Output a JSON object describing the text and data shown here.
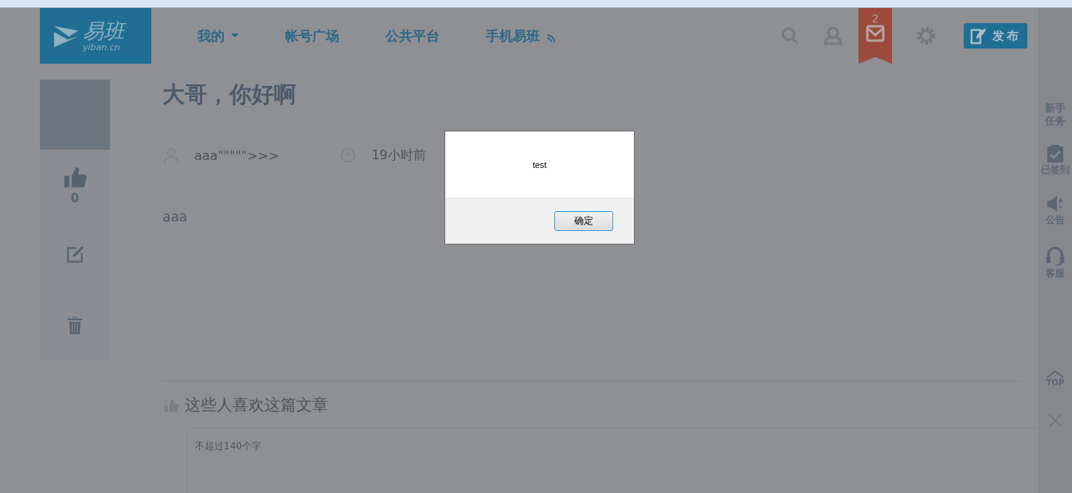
{
  "header": {
    "logo": {
      "name": "易班",
      "domain": "yiban.cn"
    },
    "nav": [
      {
        "label": "我的",
        "dropdown": true,
        "signal": false
      },
      {
        "label": "帐号广场",
        "dropdown": false,
        "signal": false
      },
      {
        "label": "公共平台",
        "dropdown": false,
        "signal": false
      },
      {
        "label": "手机易班",
        "dropdown": false,
        "signal": true
      }
    ],
    "mail_count": "2",
    "publish_button": "发布"
  },
  "side_actions": [
    {
      "kind": "like",
      "count": "0"
    },
    {
      "kind": "edit"
    },
    {
      "kind": "delete"
    }
  ],
  "article": {
    "title": "大哥，你好啊",
    "author": "aaa\"\"\"\"\">>>",
    "time": "19小时前",
    "body": "aaa"
  },
  "likes": {
    "heading": "这些人喜欢这篇文章"
  },
  "comment": {
    "placeholder": "不超过140个字"
  },
  "right_rail": [
    {
      "kind": "task",
      "label": "新手任务"
    },
    {
      "kind": "checkin",
      "label": "已签到"
    },
    {
      "kind": "notice",
      "label": "公告"
    },
    {
      "kind": "service",
      "label": "客服"
    },
    {
      "kind": "top",
      "label": "TOP"
    },
    {
      "kind": "close"
    }
  ],
  "dialog": {
    "message": "test",
    "ok_button": "确定"
  }
}
